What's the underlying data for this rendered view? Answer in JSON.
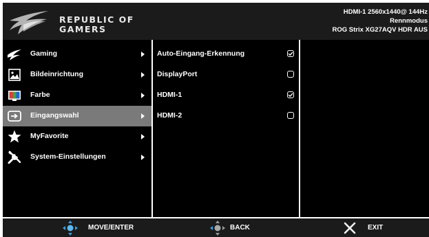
{
  "header": {
    "brand_line1": "REPUBLIC OF",
    "brand_line2": "GAMERS",
    "status_line1": "HDMI-1  2560x1440@  144Hz",
    "status_line2": "Rennmodus",
    "status_line3": "ROG Strix XG27AQV   HDR AUS"
  },
  "menu": {
    "items": [
      {
        "label": "Gaming",
        "icon": "rog-eye-icon"
      },
      {
        "label": "Bildeinrichtung",
        "icon": "image-icon"
      },
      {
        "label": "Farbe",
        "icon": "color-icon"
      },
      {
        "label": "Eingangswahl",
        "icon": "input-icon",
        "selected": true
      },
      {
        "label": "MyFavorite",
        "icon": "star-icon"
      },
      {
        "label": "System-Einstellungen",
        "icon": "tools-icon"
      }
    ]
  },
  "options": {
    "items": [
      {
        "label": "Auto-Eingang-Erkennung",
        "checked": true
      },
      {
        "label": "DisplayPort",
        "checked": false
      },
      {
        "label": "HDMI-1",
        "checked": true
      },
      {
        "label": "HDMI-2",
        "checked": false
      }
    ]
  },
  "footer": {
    "move_label": "MOVE/ENTER",
    "back_label": "BACK",
    "exit_label": "EXIT"
  },
  "colors": {
    "header_bg": "#1b1b1b",
    "panel_bg": "#000000",
    "selected_bg": "#7a7a7a",
    "accent_blue": "#3aa0e0",
    "exit_x": "#f0f0f0"
  }
}
